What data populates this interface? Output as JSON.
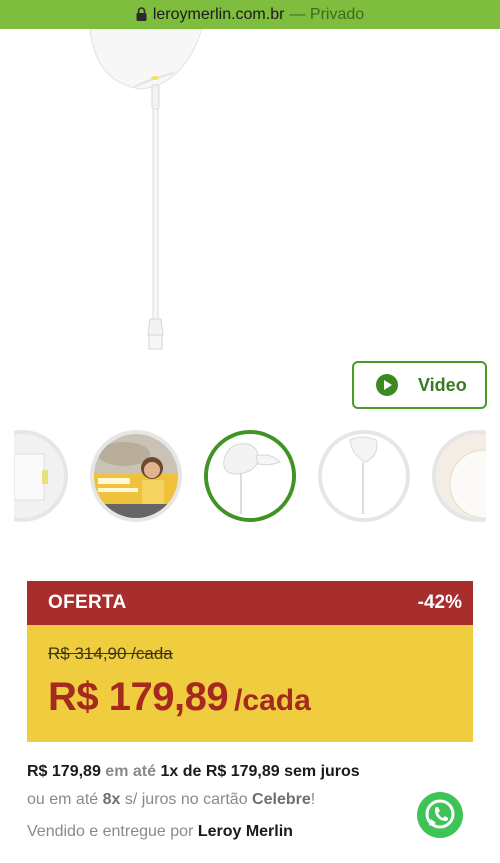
{
  "browser": {
    "domain": "leroymerlin.com.br",
    "separator": "—",
    "mode": "Privado"
  },
  "product": {
    "video_label": "Video",
    "thumbnails": [
      {
        "name": "thumbnail-1"
      },
      {
        "name": "thumbnail-2",
        "caption_a": "REPARA LAR",
        "caption_b": "Instalação de chuveiro"
      },
      {
        "name": "thumbnail-3",
        "active": true
      },
      {
        "name": "thumbnail-4"
      },
      {
        "name": "thumbnail-5"
      }
    ]
  },
  "price": {
    "offer_label": "OFERTA",
    "discount": "-42%",
    "old_price": "R$ 314,90 /cada",
    "new_price": "R$ 179,89",
    "unit": "/cada"
  },
  "installments": {
    "full_price": "R$ 179,89",
    "em_ate": "em até",
    "count": "1x de R$ 179,89 sem juros",
    "line2_pre": "ou em até",
    "line2_count": "8x",
    "line2_mid": "s/ juros no cartão",
    "line2_card": "Celebre",
    "line2_end": "!",
    "seller_pre": "Vendido e entregue por",
    "seller": "Leroy Merlin"
  },
  "colors": {
    "urlbar": "#7ebd3e",
    "offer_red": "#a82d2d",
    "price_yellow": "#efcd3f",
    "brand_green": "#3f9423",
    "whatsapp": "#3ec356"
  }
}
